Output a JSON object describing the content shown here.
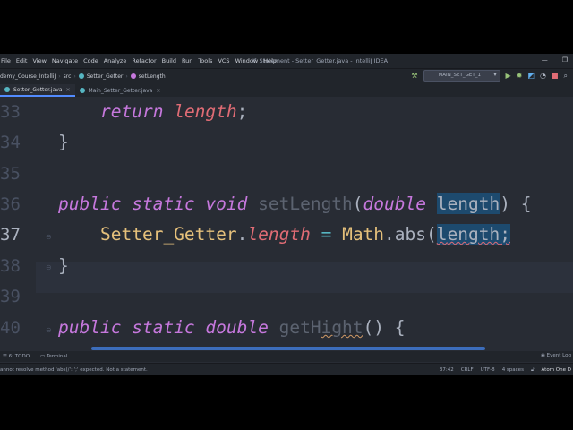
{
  "window": {
    "title": "If_Statement - Setter_Getter.java - IntelliJ IDEA",
    "controls": [
      "—",
      "❐"
    ]
  },
  "menu": [
    "File",
    "Edit",
    "View",
    "Navigate",
    "Code",
    "Analyze",
    "Refactor",
    "Build",
    "Run",
    "Tools",
    "VCS",
    "Window",
    "Help"
  ],
  "breadcrumbs": [
    "demy_Course_IntelliJ",
    "src",
    "Setter_Getter",
    "setLength"
  ],
  "run_config": {
    "label": "MAIN_SET_GET_1"
  },
  "tabs": [
    {
      "label": "Setter_Getter.java",
      "active": true
    },
    {
      "label": "Main_Setter_Getter.java",
      "active": false
    }
  ],
  "line_numbers": [
    "33",
    "34",
    "35",
    "36",
    "37",
    "38",
    "39",
    "40"
  ],
  "current_line": "37",
  "code": {
    "l33": {
      "kw_return": "return",
      "ident": "length",
      "semi": ";"
    },
    "l34": {
      "brace": "}"
    },
    "l36": {
      "kw_public": "public",
      "kw_static": "static",
      "kw_void": "void",
      "fn": "setLength",
      "lp": "(",
      "type": "double",
      "param": "length",
      "rp": ")",
      "lb": "{"
    },
    "l37": {
      "cls": "Setter_Getter",
      "dot": ".",
      "field": "length",
      "eq": "=",
      "math": "Math",
      "abs": ".abs(",
      "arg_l": "l",
      "arg_rest": "ength",
      "semi": ";"
    },
    "l38": {
      "brace": "}"
    },
    "l40": {
      "kw_public": "public",
      "kw_static": "static",
      "kw_double": "double",
      "fn_a": "getH",
      "fn_b": "ight",
      "parens": "()",
      "lb": "{"
    }
  },
  "bottom_tools": {
    "todo": "6: TODO",
    "terminal": "Terminal",
    "event_log": "Event Log"
  },
  "status": {
    "message": "annot resolve method 'abs(/': ';' expected. Not a statement.",
    "position": "37:42",
    "line_sep": "CRLF",
    "encoding": "UTF-8",
    "indent": "4 spaces",
    "theme": "Atom One D"
  },
  "colors": {
    "background": "#282c34",
    "keyword": "#c678dd",
    "identifier": "#e06c75",
    "accent": "#528bff"
  }
}
